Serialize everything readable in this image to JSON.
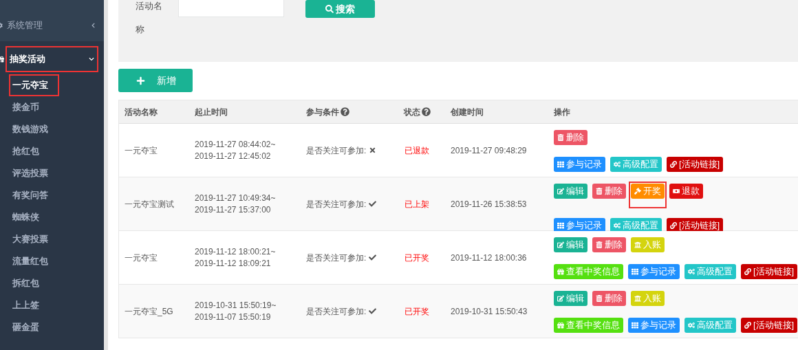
{
  "sidebar": {
    "groups": [
      {
        "label": "系统管理",
        "expanded": false,
        "annotated": false
      },
      {
        "label": "抽奖活动",
        "expanded": true,
        "annotated": true,
        "children": [
          {
            "label": "一元夺宝",
            "selected": true,
            "annotated": true
          },
          {
            "label": "接金币",
            "selected": false,
            "annotated": false
          },
          {
            "label": "数钱游戏",
            "selected": false,
            "annotated": false
          },
          {
            "label": "抢红包",
            "selected": false,
            "annotated": false
          },
          {
            "label": "评选投票",
            "selected": false,
            "annotated": false
          },
          {
            "label": "有奖问答",
            "selected": false,
            "annotated": false
          },
          {
            "label": "蜘蛛侠",
            "selected": false,
            "annotated": false
          },
          {
            "label": "大赛投票",
            "selected": false,
            "annotated": false
          },
          {
            "label": "流量红包",
            "selected": false,
            "annotated": false
          },
          {
            "label": "拆红包",
            "selected": false,
            "annotated": false
          },
          {
            "label": "上上签",
            "selected": false,
            "annotated": false
          },
          {
            "label": "砸金蛋",
            "selected": false,
            "annotated": false
          }
        ]
      }
    ]
  },
  "search": {
    "label": "活动名称",
    "button": "搜索"
  },
  "add_button": "新增",
  "table": {
    "columns": [
      {
        "label": "活动名称",
        "help": false
      },
      {
        "label": "起止时间",
        "help": false
      },
      {
        "label": "参与条件",
        "help": true
      },
      {
        "label": "状态",
        "help": true
      },
      {
        "label": "创建时间",
        "help": false
      },
      {
        "label": "操作",
        "help": false
      }
    ],
    "rows": [
      {
        "name": "一元夺宝",
        "start": "2019-11-27 08:44:02~",
        "end": "2019-11-27 12:45:02",
        "condition": "是否关注可参加:",
        "follow_required": false,
        "status": "已退款",
        "created": "2019-11-27 09:48:29",
        "actions": [
          [
            {
              "kind": "delete",
              "label": "删除",
              "annotated": false
            }
          ],
          [
            {
              "kind": "records",
              "label": "参与记录",
              "annotated": false
            },
            {
              "kind": "config",
              "label": "高级配置",
              "annotated": false
            },
            {
              "kind": "link",
              "label": "[活动链接]",
              "annotated": false
            }
          ]
        ]
      },
      {
        "name": "一元夺宝测试",
        "start": "2019-11-27 10:49:34~",
        "end": "2019-11-27 15:37:00",
        "condition": "是否关注可参加:",
        "follow_required": true,
        "status": "已上架",
        "created": "2019-11-26 15:38:53",
        "actions": [
          [
            {
              "kind": "edit",
              "label": "编辑",
              "annotated": false
            },
            {
              "kind": "delete",
              "label": "删除",
              "annotated": false
            },
            {
              "kind": "draw",
              "label": "开奖",
              "annotated": true
            },
            {
              "kind": "refund",
              "label": "退款",
              "annotated": false
            }
          ],
          [
            {
              "kind": "records",
              "label": "参与记录",
              "annotated": false
            },
            {
              "kind": "config",
              "label": "高级配置",
              "annotated": false
            },
            {
              "kind": "link",
              "label": "[活动链接]",
              "annotated": false
            }
          ]
        ]
      },
      {
        "name": "一元夺宝",
        "start": "2019-11-12 18:00:21~",
        "end": "2019-11-12 18:09:21",
        "condition": "是否关注可参加:",
        "follow_required": true,
        "status": "已开奖",
        "created": "2019-11-12 18:00:36",
        "actions": [
          [
            {
              "kind": "edit",
              "label": "编辑",
              "annotated": false
            },
            {
              "kind": "delete",
              "label": "删除",
              "annotated": false
            },
            {
              "kind": "account",
              "label": "入账",
              "annotated": false
            }
          ],
          [
            {
              "kind": "winners",
              "label": "查看中奖信息",
              "annotated": false
            },
            {
              "kind": "records",
              "label": "参与记录",
              "annotated": false
            },
            {
              "kind": "config",
              "label": "高级配置",
              "annotated": false
            },
            {
              "kind": "link",
              "label": "[活动链接]",
              "annotated": false
            }
          ]
        ]
      },
      {
        "name": "一元夺宝_5G",
        "start": "2019-10-31 15:50:19~",
        "end": "2019-11-07 15:50:19",
        "condition": "是否关注可参加:",
        "follow_required": true,
        "status": "已开奖",
        "created": "2019-10-31 15:50:43",
        "actions": [
          [
            {
              "kind": "edit",
              "label": "编辑",
              "annotated": false
            },
            {
              "kind": "delete",
              "label": "删除",
              "annotated": false
            },
            {
              "kind": "account",
              "label": "入账",
              "annotated": false
            }
          ],
          [
            {
              "kind": "winners",
              "label": "查看中奖信息",
              "annotated": false
            },
            {
              "kind": "records",
              "label": "参与记录",
              "annotated": false
            },
            {
              "kind": "config",
              "label": "高级配置",
              "annotated": false
            },
            {
              "kind": "link",
              "label": "[活动链接]",
              "annotated": false
            }
          ]
        ]
      }
    ]
  }
}
